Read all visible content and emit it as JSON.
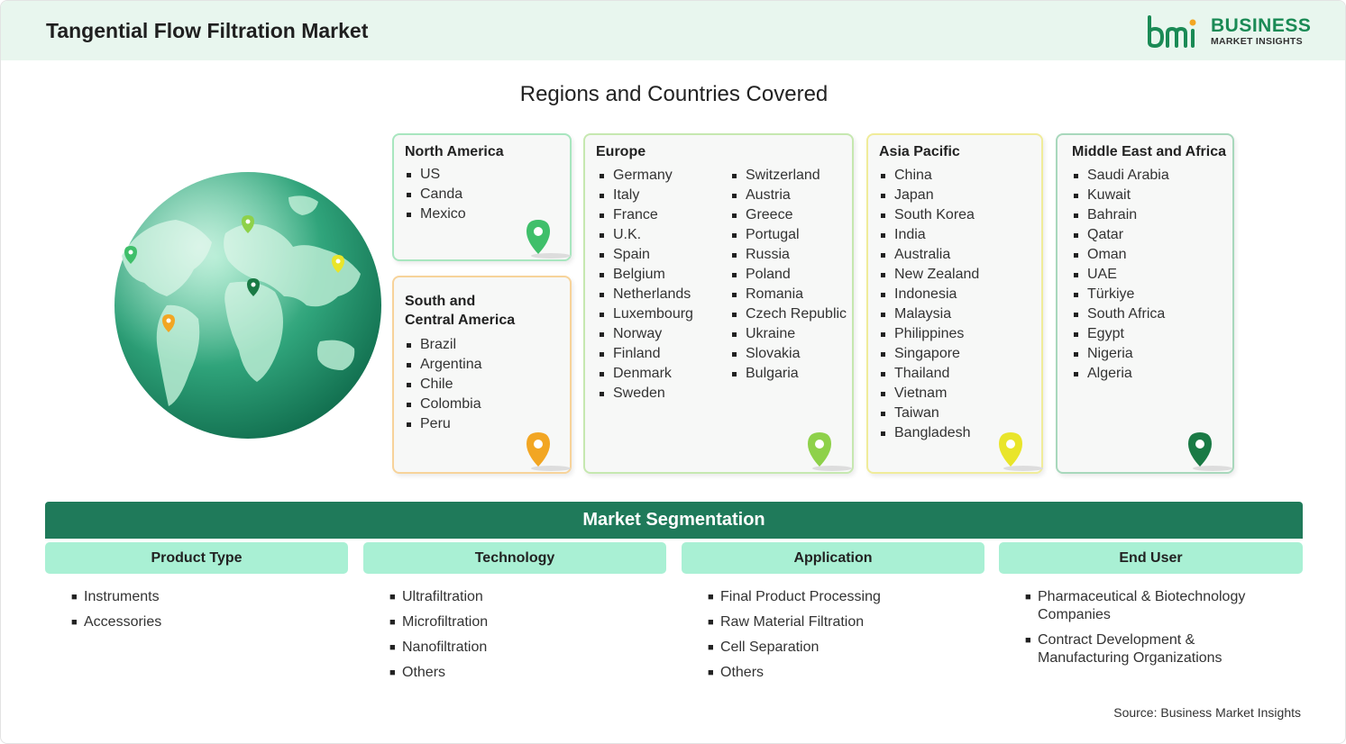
{
  "header": {
    "title": "Tangential Flow Filtration Market"
  },
  "logo": {
    "line1": "BUSINESS",
    "line2": "MARKET INSIGHTS"
  },
  "regions_title": "Regions and Countries Covered",
  "regions": {
    "north_america": {
      "title": "North America",
      "countries": [
        "US",
        "Canda",
        "Mexico"
      ],
      "pin_color": "#3fbf6a"
    },
    "south_america": {
      "title_line1": "South and",
      "title_line2": "Central America",
      "countries": [
        "Brazil",
        "Argentina",
        "Chile",
        "Colombia",
        "Peru"
      ],
      "pin_color": "#f2a623"
    },
    "europe": {
      "title": "Europe",
      "countries_col1": [
        "Germany",
        "Italy",
        "France",
        "U.K.",
        "Spain",
        "Belgium",
        "Netherlands",
        "Luxembourg",
        "Norway",
        "Finland",
        "Denmark",
        "Sweden"
      ],
      "countries_col2": [
        "Switzerland",
        "Austria",
        "Greece",
        "Portugal",
        "Russia",
        "Poland",
        "Romania",
        "Czech Republic",
        "Ukraine",
        "Slovakia",
        "Bulgaria"
      ],
      "pin_color": "#8ed14a"
    },
    "asia_pacific": {
      "title": "Asia Pacific",
      "countries": [
        "China",
        "Japan",
        "South Korea",
        "India",
        "Australia",
        "New Zealand",
        "Indonesia",
        "Malaysia",
        "Philippines",
        "Singapore",
        "Thailand",
        "Vietnam",
        "Taiwan",
        "Bangladesh"
      ],
      "pin_color": "#e9e52a"
    },
    "mea": {
      "title": "Middle East and Africa",
      "countries": [
        "Saudi Arabia",
        "Kuwait",
        "Bahrain",
        "Qatar",
        "Oman",
        "UAE",
        "Türkiye",
        "South Africa",
        "Egypt",
        "Nigeria",
        "Algeria"
      ],
      "pin_color": "#1a7a45"
    }
  },
  "segmentation": {
    "title": "Market Segmentation",
    "columns": [
      {
        "heading": "Product Type",
        "items": [
          "Instruments",
          "Accessories"
        ]
      },
      {
        "heading": "Technology",
        "items": [
          "Ultrafiltration",
          "Microfiltration",
          "Nanofiltration",
          "Others"
        ]
      },
      {
        "heading": "Application",
        "items": [
          "Final Product Processing",
          "Raw Material Filtration",
          "Cell Separation",
          "Others"
        ]
      },
      {
        "heading": "End User",
        "items": [
          "Pharmaceutical & Biotechnology Companies",
          "Contract Development & Manufacturing Organizations"
        ]
      }
    ]
  },
  "source": "Source: Business Market Insights",
  "colors": {
    "brand_green": "#1f7a5a",
    "header_bg": "#e8f6ee",
    "seg_head_bg": "#a9f0d4"
  }
}
